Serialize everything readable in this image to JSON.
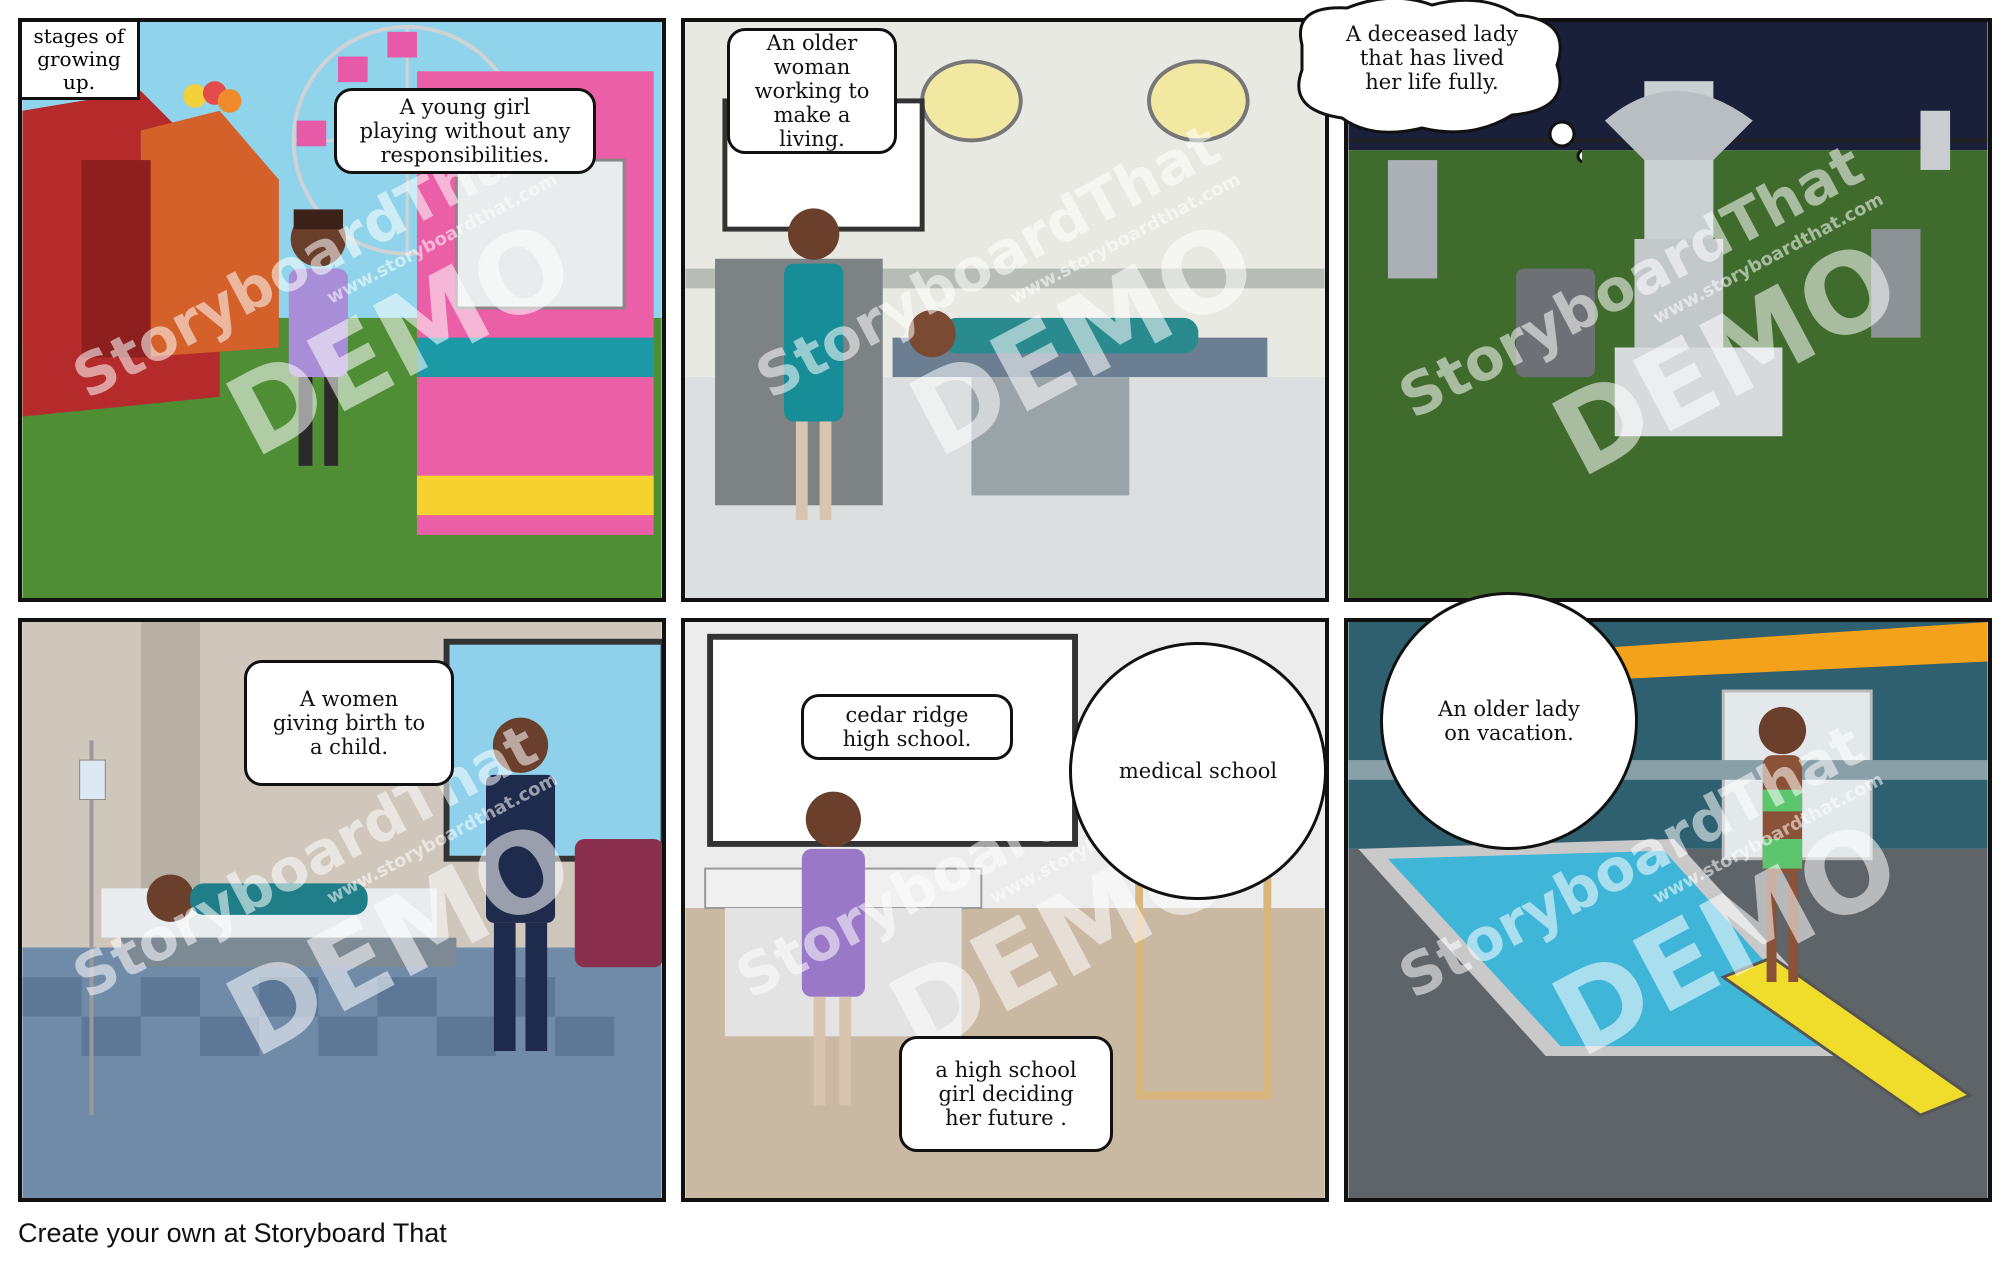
{
  "footer": {
    "text": "Create your own at Storyboard That"
  },
  "watermark": {
    "brand": "StoryboardThat",
    "url": "www.storyboardthat.com",
    "demo": "DEMO"
  },
  "panels": [
    {
      "caption": "stages of\ngrowing\nup.",
      "bubble": "A young girl\nplaying without any\nresponsibilities."
    },
    {
      "bubble": "An older\nwoman\nworking to\nmake a\nliving."
    },
    {
      "bubble": "A deceased lady\nthat has lived\nher  life fully."
    },
    {
      "bubble": "A women\ngiving birth to\na child."
    },
    {
      "bubble_top": "cedar ridge\nhigh school.",
      "bubble_circle": "medical school",
      "bubble_bottom": "a high school\ngirl deciding\nher future ."
    },
    {
      "bubble": "An older lady\non vacation."
    }
  ],
  "colors": {
    "border": "#111111",
    "grass": "#4a8a35",
    "night_sky": "#1a1f3a",
    "pool": "#3fb6d8"
  }
}
